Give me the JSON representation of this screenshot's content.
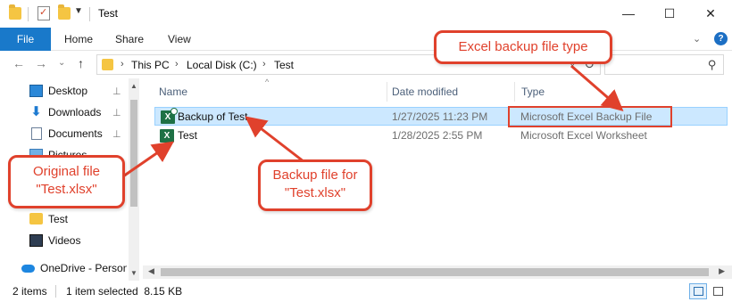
{
  "window": {
    "title": "Test",
    "icons": [
      "folder-icon",
      "properties-icon",
      "new-folder-icon",
      "quick-access-dropdown-icon"
    ],
    "controls": {
      "minimize": "—",
      "maximize": "☐",
      "close": "✕"
    }
  },
  "ribbon": {
    "tabs": [
      "File",
      "Home",
      "Share",
      "View"
    ],
    "expand_glyph": "⌄",
    "help_glyph": "?"
  },
  "address": {
    "back_glyph": "←",
    "forward_glyph": "→",
    "recent_glyph": "⌄",
    "up_glyph": "↑",
    "crumbs": [
      "This PC",
      "Local Disk (C:)",
      "Test"
    ],
    "chevron": "›",
    "dropdown_glyph": "⌄",
    "refresh_glyph": "↻",
    "search_placeholder": "",
    "search_glyph": "⚲"
  },
  "nav": {
    "items": [
      {
        "label": "Desktop",
        "icon": "desktop-icon",
        "pinned": true
      },
      {
        "label": "Downloads",
        "icon": "download-arrow-icon",
        "pinned": true
      },
      {
        "label": "Documents",
        "icon": "documents-icon",
        "pinned": true
      },
      {
        "label": "Pictures",
        "icon": "pictures-icon",
        "pinned": true
      },
      {
        "label": "Test",
        "icon": "folder-icon",
        "pinned": false
      },
      {
        "label": "Videos",
        "icon": "videos-icon",
        "pinned": false
      },
      {
        "label": "OneDrive - Person",
        "icon": "onedrive-cloud-icon",
        "pinned": false
      }
    ],
    "pin_glyph": "📌"
  },
  "filelist": {
    "columns": [
      "Name",
      "Date modified",
      "Type"
    ],
    "sort_glyph": "^",
    "rows": [
      {
        "name": "Backup of Test",
        "date": "1/27/2025 11:23 PM",
        "type": "Microsoft Excel Backup File",
        "selected": true,
        "icon": "excel-backup-icon"
      },
      {
        "name": "Test",
        "date": "1/28/2025 2:55 PM",
        "type": "Microsoft Excel Worksheet",
        "selected": false,
        "icon": "excel-icon"
      }
    ]
  },
  "status": {
    "item_count": "2 items",
    "selection": "1 item selected  8.15 KB"
  },
  "annotations": {
    "type_callout": "Excel backup file type",
    "backup_callout": "Backup file for \"Test.xlsx\"",
    "original_callout": "Original file \"Test.xlsx\""
  },
  "colors": {
    "accent": "#1979ca",
    "selection_fill": "#cce8ff",
    "selection_border": "#99d1ff",
    "annotation_red": "#e0412c",
    "excel_green": "#1e7145",
    "folder_yellow": "#f5c542"
  }
}
